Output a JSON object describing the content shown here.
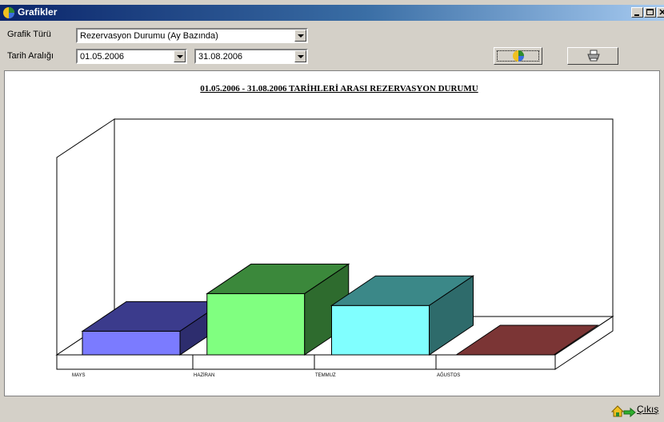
{
  "window": {
    "title": "Grafikler"
  },
  "controls": {
    "chart_type_label": "Grafik Türü",
    "chart_type_value": "Rezervasyon Durumu (Ay Bazında)",
    "date_range_label": "Tarih Aralığı",
    "start_date": "01.05.2006",
    "end_date": "31.08.2006"
  },
  "toolbar": {
    "chart_button_icon": "chart-icon",
    "print_button_icon": "printer-icon"
  },
  "footer": {
    "exit_label": "Çıkış",
    "exit_icon": "exit-icon"
  },
  "chart_data": {
    "type": "bar",
    "title": "01.05.2006 - 31.08.2006  TARİHLERİ ARASI REZERVASYON DURUMU",
    "categories": [
      "MAYS",
      "HAZİRAN",
      "TEMMUZ",
      "AĞUSTOS"
    ],
    "values": [
      1.2,
      3.1,
      2.5,
      0
    ],
    "ylim": [
      0,
      10
    ],
    "grid": false,
    "colors": [
      {
        "front": "#7b7bff",
        "top": "#3b3b8c",
        "side": "#2d2d6e"
      },
      {
        "front": "#80ff80",
        "top": "#3b883b",
        "side": "#2e6b2e"
      },
      {
        "front": "#80ffff",
        "top": "#3b8888",
        "side": "#2e6b6b"
      },
      {
        "front": "#a04848",
        "top": "#7b3535",
        "side": "#5e2828"
      }
    ]
  }
}
